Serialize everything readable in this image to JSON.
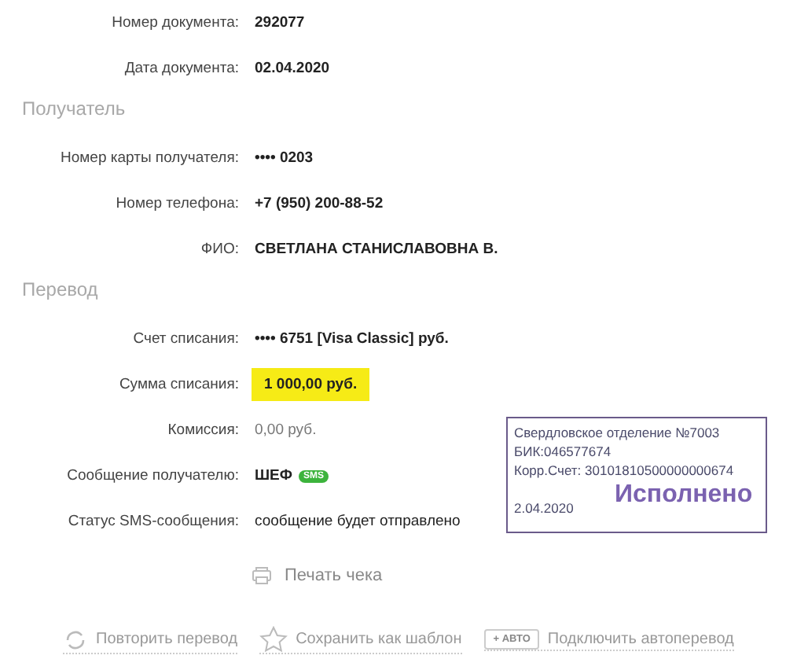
{
  "sections": [
    {
      "rows": [
        {
          "label": "Номер документа:",
          "value": "292077",
          "kind": "bold"
        },
        {
          "label": "Дата документа:",
          "value": "02.04.2020",
          "kind": "bold"
        }
      ]
    },
    {
      "title": "Получатель",
      "rows": [
        {
          "label": "Номер карты получателя:",
          "value": "•••• 0203",
          "kind": "bold"
        },
        {
          "label": "Номер телефона:",
          "value": "+7 (950) 200-88-52",
          "kind": "bold"
        },
        {
          "label": "ФИО:",
          "value": "СВЕТЛАНА СТАНИСЛАВОВНА В.",
          "kind": "bold"
        }
      ]
    },
    {
      "title": "Перевод",
      "rows": [
        {
          "label": "Счет списания:",
          "value": "•••• 6751  [Visa Classic]  руб.",
          "kind": "bold"
        },
        {
          "label": "Сумма списания:",
          "value": "1 000,00  руб.",
          "kind": "highlight"
        },
        {
          "label": "Комиссия:",
          "value": "0,00 руб.",
          "kind": "muted"
        },
        {
          "label": "Сообщение получателю:",
          "value": "ШЕФ",
          "kind": "sms",
          "badge": "SMS"
        },
        {
          "label": "Статус SMS-сообщения:",
          "value": "сообщение будет отправлено",
          "kind": "plain"
        }
      ]
    }
  ],
  "print_link": "Печать чека",
  "actions": [
    {
      "kind": "repeat",
      "label": "Повторить перевод"
    },
    {
      "kind": "template",
      "label": "Сохранить как шаблон"
    },
    {
      "kind": "auto",
      "tag": "+ АВТО",
      "label": "Подключить автоперевод"
    }
  ],
  "stamp": {
    "lines": [
      "Свердловское отделение №7003",
      "БИК:046577674",
      "Корр.Счет: 30101810500000000674"
    ],
    "status": "Исполнено",
    "date": "2.04.2020"
  }
}
